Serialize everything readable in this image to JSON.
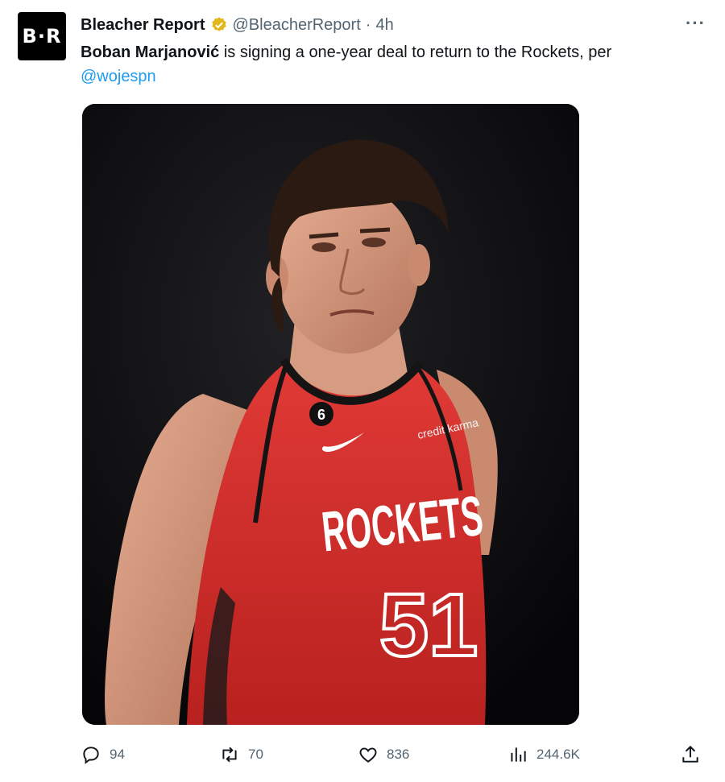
{
  "tweet": {
    "avatar_text": "B·R",
    "display_name": "Bleacher Report",
    "handle": "@BleacherReport",
    "separator": "·",
    "time": "4h",
    "more_label": "···",
    "text_bold": "Boban Marjanović",
    "text_rest": " is signing a one-year deal to return to the Rockets, per",
    "mention": "@wojespn",
    "media": {
      "jersey_team": "ROCKETS",
      "jersey_number": "51",
      "patch_number": "6",
      "sponsor": "credit karma"
    },
    "metrics": {
      "replies": "94",
      "retweets": "70",
      "likes": "836",
      "views": "244.6K"
    }
  },
  "colors": {
    "verified": "#e2b719",
    "link": "#1d9bf0",
    "muted": "#536471",
    "jersey": "#d42b2b"
  }
}
